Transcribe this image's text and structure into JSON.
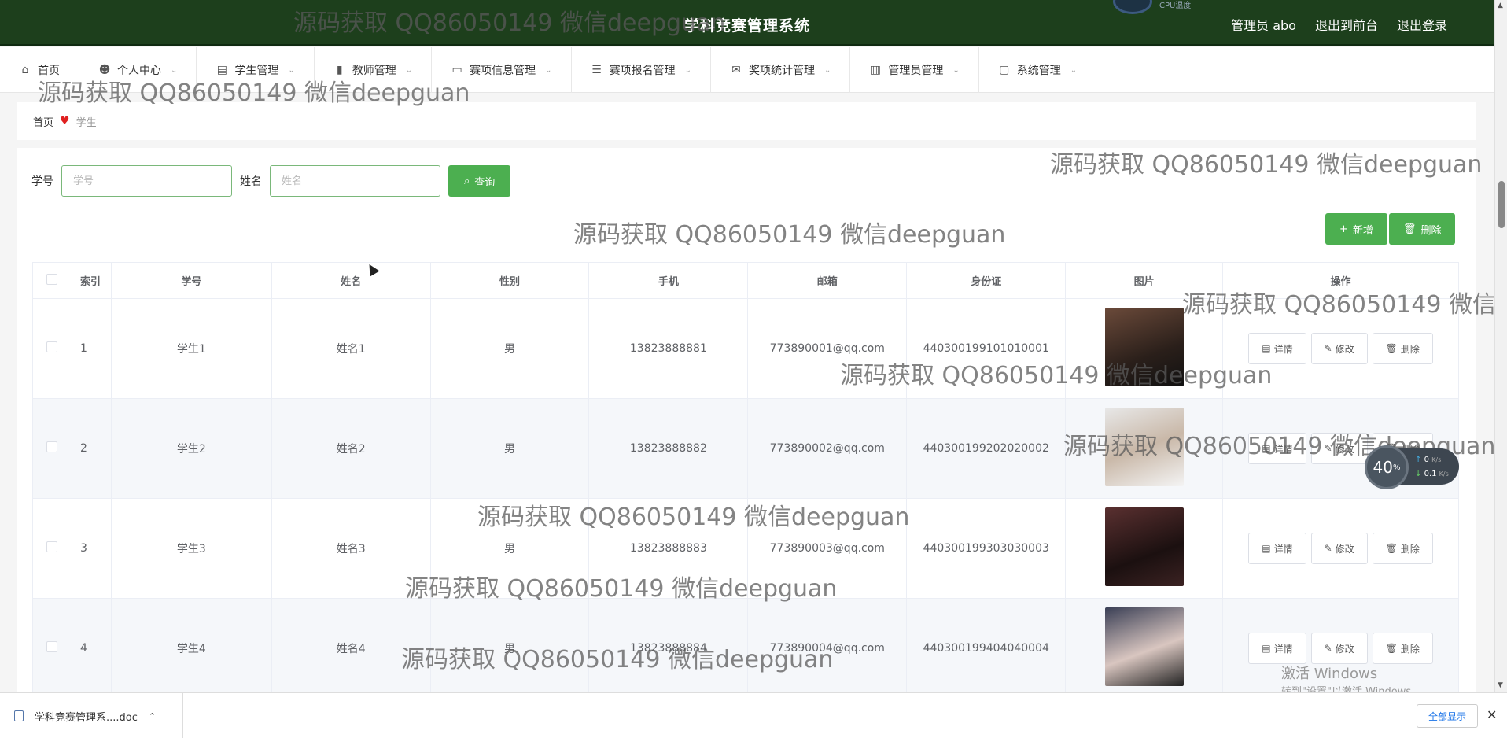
{
  "header": {
    "title": "学科竞赛管理系统",
    "cpu_label": "CPU温度",
    "admin": "管理员 abo",
    "back_front": "退出到前台",
    "logout": "退出登录"
  },
  "nav": [
    {
      "label": "首页",
      "icon": "home-icon",
      "glyph": "⌂",
      "has_chevron": false
    },
    {
      "label": "个人中心",
      "icon": "user-icon",
      "glyph": "☻",
      "has_chevron": true
    },
    {
      "label": "学生管理",
      "icon": "chart-icon",
      "glyph": "▤",
      "has_chevron": true
    },
    {
      "label": "教师管理",
      "icon": "bar-chart-icon",
      "glyph": "▮",
      "has_chevron": true
    },
    {
      "label": "赛项信息管理",
      "icon": "monitor-icon",
      "glyph": "▭",
      "has_chevron": true
    },
    {
      "label": "赛项报名管理",
      "icon": "list-icon",
      "glyph": "☰",
      "has_chevron": true
    },
    {
      "label": "奖项统计管理",
      "icon": "mail-icon",
      "glyph": "✉",
      "has_chevron": true
    },
    {
      "label": "管理员管理",
      "icon": "stats-icon",
      "glyph": "▥",
      "has_chevron": true
    },
    {
      "label": "系统管理",
      "icon": "chat-icon",
      "glyph": "▢",
      "has_chevron": true
    }
  ],
  "breadcrumb": {
    "home": "首页",
    "current": "学生"
  },
  "search": {
    "student_no_label": "学号",
    "student_no_placeholder": "学号",
    "name_label": "姓名",
    "name_placeholder": "姓名",
    "query_button": "查询"
  },
  "toolbar": {
    "add": "新增",
    "delete": "删除"
  },
  "table": {
    "headers": [
      "索引",
      "学号",
      "姓名",
      "性别",
      "手机",
      "邮箱",
      "身份证",
      "图片",
      "操作"
    ],
    "rows": [
      {
        "index": "1",
        "student_no": "学生1",
        "name": "姓名1",
        "gender": "男",
        "phone": "13823888881",
        "email": "773890001@qq.com",
        "id_card": "440300199101010001"
      },
      {
        "index": "2",
        "student_no": "学生2",
        "name": "姓名2",
        "gender": "男",
        "phone": "13823888882",
        "email": "773890002@qq.com",
        "id_card": "440300199202020002"
      },
      {
        "index": "3",
        "student_no": "学生3",
        "name": "姓名3",
        "gender": "男",
        "phone": "13823888883",
        "email": "773890003@qq.com",
        "id_card": "440300199303030003"
      },
      {
        "index": "4",
        "student_no": "学生4",
        "name": "姓名4",
        "gender": "男",
        "phone": "13823888884",
        "email": "773890004@qq.com",
        "id_card": "440300199404040004"
      }
    ],
    "ops": {
      "detail": "详情",
      "edit": "修改",
      "delete": "删除"
    }
  },
  "download_bar": {
    "file": "学科竞赛管理系....doc",
    "show_all": "全部显示"
  },
  "net_widget": {
    "percent": "40",
    "unit": "%",
    "up": "0",
    "down": "0.1",
    "rate_unit": "K/s"
  },
  "windows": {
    "line1": "激活 Windows",
    "line2": "转到\"设置\"以激活 Windows。"
  },
  "watermark": "源码获取 QQ86050149 微信deepguan"
}
